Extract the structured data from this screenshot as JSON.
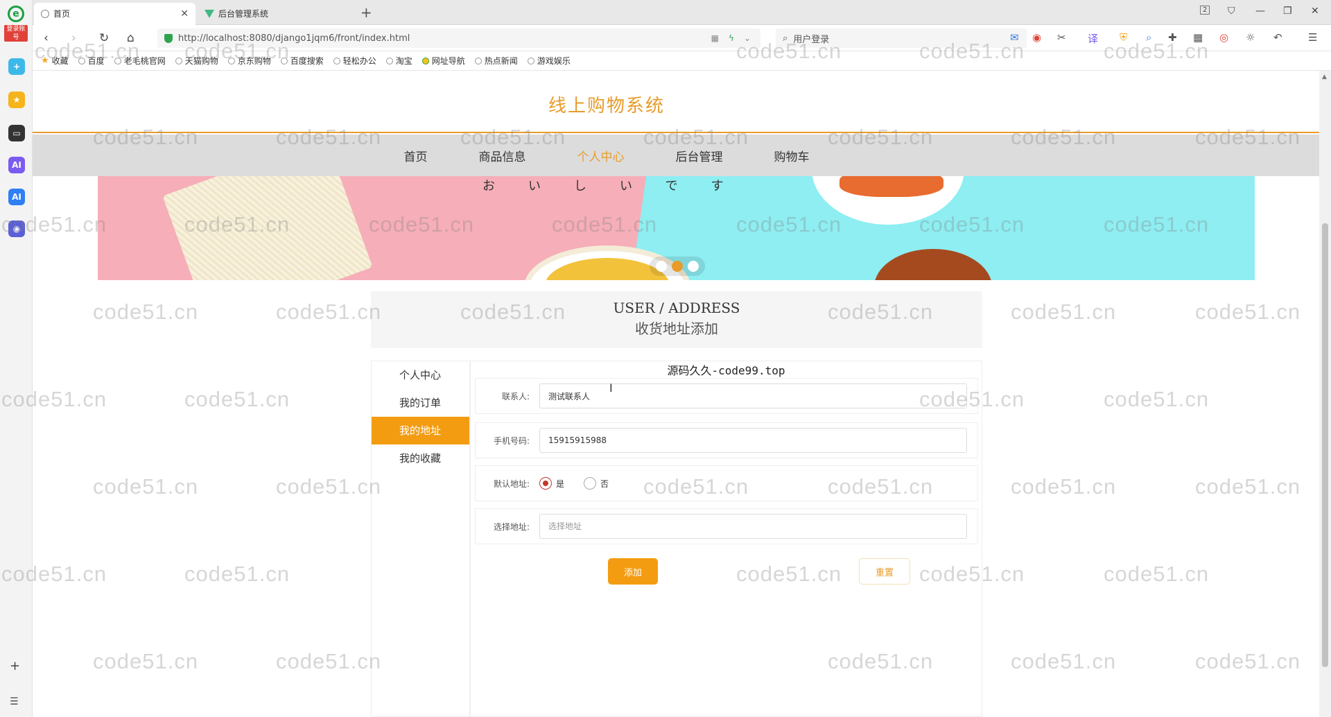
{
  "browser": {
    "side_login_tag": "登录账号",
    "tabs": [
      {
        "title": "首页",
        "active": true
      },
      {
        "title": "后台管理系统",
        "active": false
      }
    ],
    "url": "http://localhost:8080/django1jqm6/front/index.html",
    "search_placeholder": "用户登录",
    "tab_count": "2",
    "bookmarks": [
      "收藏",
      "百度",
      "老毛桃官网",
      "天猫购物",
      "京东购物",
      "百度搜索",
      "轻松办公",
      "淘宝",
      "网址导航",
      "热点新闻",
      "游戏娱乐"
    ]
  },
  "site": {
    "title": "线上购物系统",
    "nav": [
      {
        "label": "首页",
        "active": false
      },
      {
        "label": "商品信息",
        "active": false
      },
      {
        "label": "个人中心",
        "active": true
      },
      {
        "label": "后台管理",
        "active": false
      },
      {
        "label": "购物车",
        "active": false
      }
    ],
    "banner": {
      "caption": "おいしいです",
      "slides": 3,
      "active_slide": 2
    }
  },
  "section": {
    "title_en": "USER / ADDRESS",
    "title_cn": "收货地址添加"
  },
  "sidebar": {
    "items": [
      {
        "label": "个人中心",
        "active": false
      },
      {
        "label": "我的订单",
        "active": false
      },
      {
        "label": "我的地址",
        "active": true
      },
      {
        "label": "我的收藏",
        "active": false
      }
    ]
  },
  "form": {
    "source_tag": "源码久久-code99.top",
    "contact_label": "联系人:",
    "contact_value": "测试联系人",
    "phone_label": "手机号码:",
    "phone_value": "15915915988",
    "default_label": "默认地址:",
    "default_options": [
      {
        "label": "是",
        "checked": true
      },
      {
        "label": "否",
        "checked": false
      }
    ],
    "address_label": "选择地址:",
    "address_placeholder": "选择地址",
    "add_button": "添加",
    "reset_button": "重置"
  },
  "watermark_text": "code51.cn",
  "colors": {
    "accent": "#e89b2a",
    "active_menu": "#f39c12",
    "nav_bg": "#dcdcdc"
  }
}
